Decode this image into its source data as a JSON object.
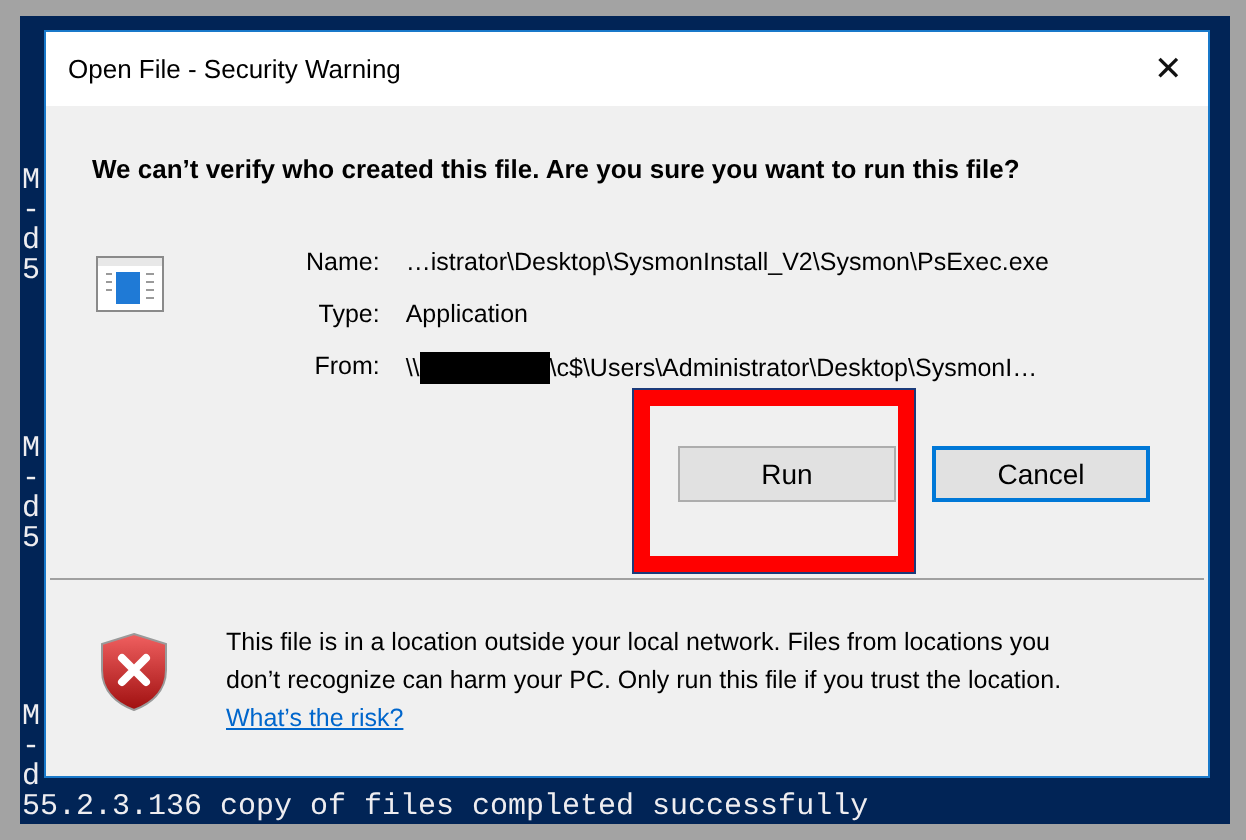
{
  "console": {
    "blocks": [
      {
        "lines": [
          "M",
          "-",
          "d",
          "5"
        ]
      },
      {
        "lines": [
          "M",
          "-",
          "d",
          "5"
        ]
      },
      {
        "lines": [
          "M",
          "-",
          "d",
          "55.2.3.136 copy of files completed successfully"
        ]
      }
    ]
  },
  "dialog": {
    "title": "Open File - Security Warning",
    "close": "✕",
    "heading": "We can’t verify who created this file. Are you sure you want to run this file?",
    "fields": [
      {
        "label": "Name:",
        "value": "…istrator\\Desktop\\SysmonInstall_V2\\Sysmon\\PsExec.exe",
        "redacted": false
      },
      {
        "label": "Type:",
        "value": "Application",
        "redacted": false
      },
      {
        "label": "From:",
        "prefix": "\\\\",
        "value": "\\c$\\Users\\Administrator\\Desktop\\SysmonI…",
        "redacted": true
      }
    ],
    "buttons": [
      {
        "label": "Run",
        "default": false,
        "highlighted": true
      },
      {
        "label": "Cancel",
        "default": true,
        "highlighted": false
      }
    ],
    "warning": {
      "text": "This file is in a location outside your local network. Files from locations you don’t recognize can harm your PC. Only run this file if you trust the location.",
      "link": "What’s the risk?"
    }
  }
}
